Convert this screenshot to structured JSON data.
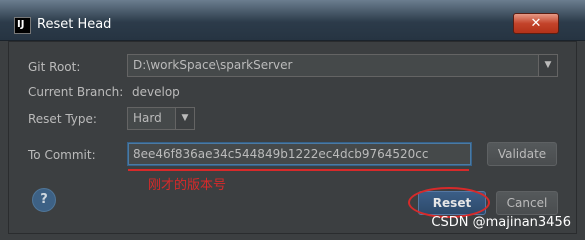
{
  "window": {
    "title": "Reset Head",
    "app_icon_text": "IJ",
    "close_symbol": "✕"
  },
  "form": {
    "git_root_label": "Git Root:",
    "git_root_value": "D:\\workSpace\\sparkServer",
    "current_branch_label": "Current Branch:",
    "current_branch_value": "develop",
    "reset_type_label": "Reset Type:",
    "reset_type_value": "Hard",
    "to_commit_label": "To Commit:",
    "to_commit_value": "8ee46f836ae34c544849b1222ec4dcb9764520cc",
    "validate_label": "Validate"
  },
  "buttons": {
    "help": "?",
    "reset": "Reset",
    "cancel": "Cancel"
  },
  "annotation": {
    "text": "刚才的版本号",
    "color": "#d72a2a"
  },
  "watermark": "CSDN @majinan3456"
}
